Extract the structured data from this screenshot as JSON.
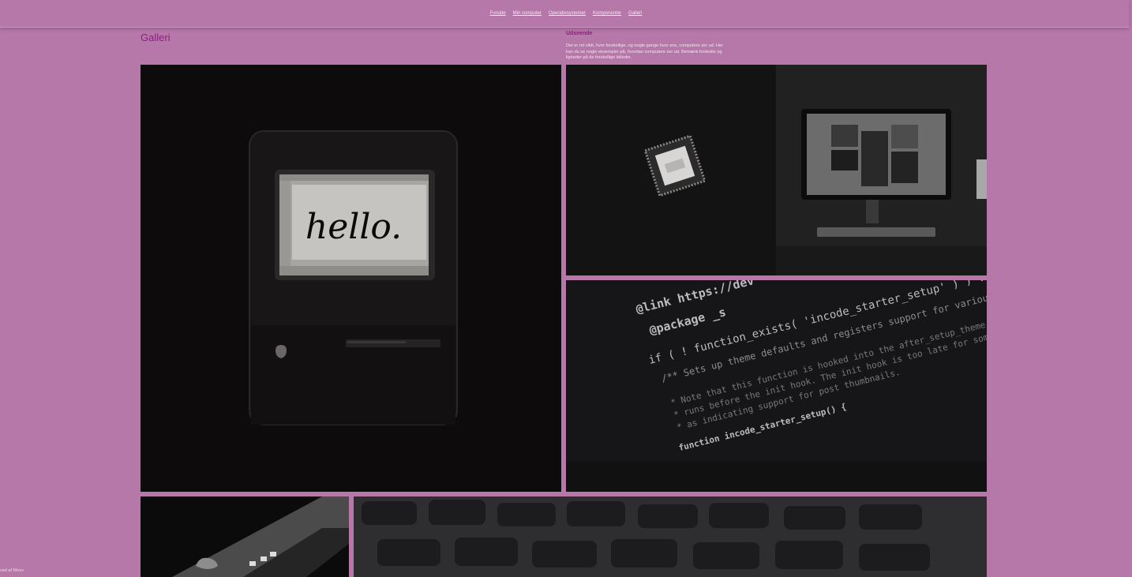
{
  "nav": {
    "items": [
      {
        "label": "Forside"
      },
      {
        "label": "Min computer"
      },
      {
        "label": "Operativsystemer"
      },
      {
        "label": "Komponenter"
      },
      {
        "label": "Galleri"
      }
    ]
  },
  "gallery": {
    "title": "Galleri"
  },
  "sidebar": {
    "heading": "Udseende",
    "text": "Det er ret vildt, hvor forskellige, og nogle gange hvor ens, computere ser ud. Her kan du se nogle eksempler på, hvordan computere ser ud. Bemærk forskelle og ligheder på de forskellige billeder."
  },
  "photos": {
    "mac_screen_text": "hello.",
    "code_lines": [
      "@link https://dev",
      "@package _s",
      "if ( ! function_exists( 'incode_starter_setup' ) ) :",
      "/** Sets up theme defaults and registers support for various WordPress",
      "* Note that this function is hooked into the after_setup_theme hook",
      "* runs before the init hook. The init hook is too late for some",
      "* as indicating support for post thumbnails.",
      "function incode_starter_setup() {"
    ]
  },
  "footer": {
    "note": "ved af Moov"
  }
}
